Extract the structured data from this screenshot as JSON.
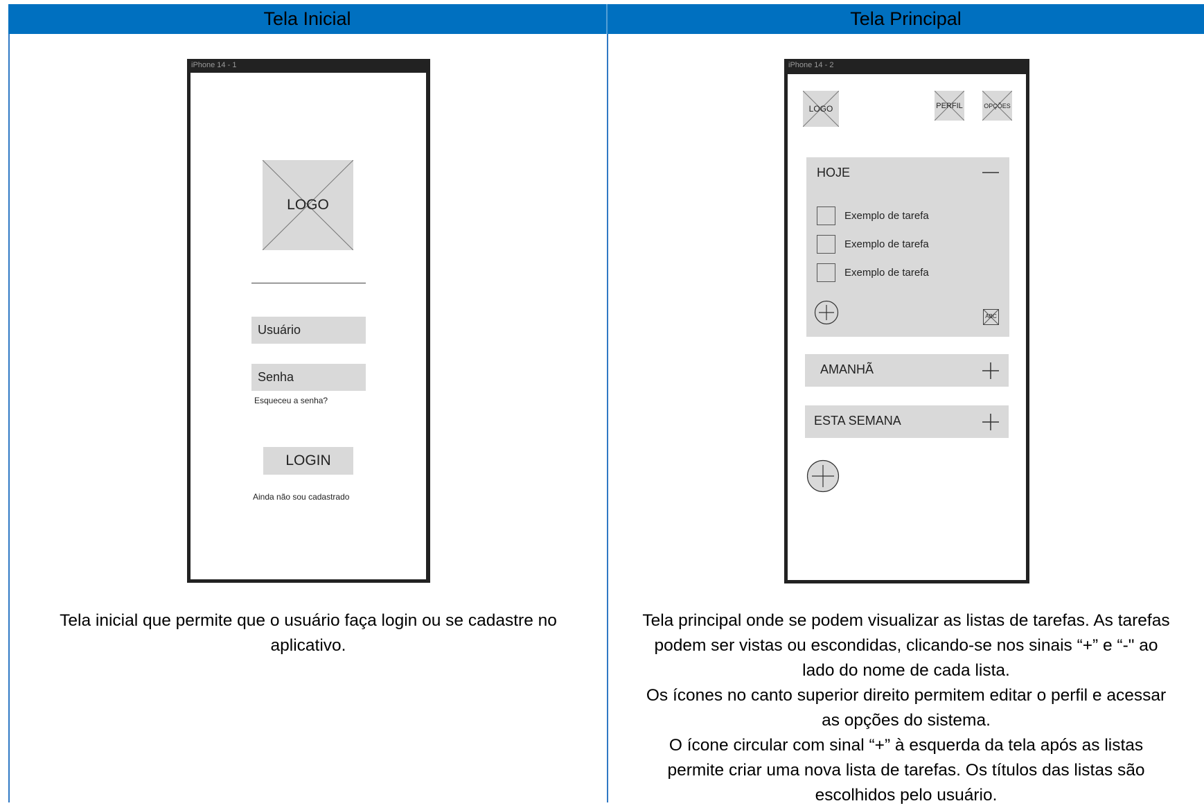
{
  "table": {
    "col1_header": "Tela Inicial",
    "col2_header": "Tela Principal"
  },
  "colors": {
    "header_bg": "#0070c0",
    "border": "#2f78c4",
    "wireframe_gray": "#d9d9d9",
    "phone_frame": "#222222"
  },
  "login_screen": {
    "frame_label": "iPhone 14 - 1",
    "logo": "LOGO",
    "username_placeholder": "Usuário",
    "password_placeholder": "Senha",
    "forgot_password": "Esqueceu a senha?",
    "login_button": "LOGIN",
    "signup_link": "Ainda não sou cadastrado"
  },
  "main_screen": {
    "frame_label": "iPhone 14 - 2",
    "logo": "LOGO",
    "profile_button": "PERFIL",
    "options_button": "OPÇÕES",
    "lists": [
      {
        "title": "HOJE",
        "toggle_icon": "minus-icon",
        "tasks": [
          "Exemplo de tarefa",
          "Exemplo de tarefa",
          "Exemplo de tarefa"
        ],
        "edit_label": "ABC"
      },
      {
        "title": "AMANHÃ",
        "toggle_icon": "plus-icon"
      },
      {
        "title": "ESTA SEMANA",
        "toggle_icon": "plus-icon"
      }
    ],
    "add_list_icon": "circle-plus-icon"
  },
  "descriptions": {
    "col1": [
      "Tela inicial que permite que o usuário faça login ou se cadastre no",
      "aplicativo."
    ],
    "col2": [
      "Tela principal onde se podem visualizar as listas de tarefas. As tarefas",
      "podem ser vistas ou escondidas, clicando-se nos sinais “+” e “-\" ao",
      "lado do nome de cada lista.",
      "Os ícones no canto superior direito permitem editar o perfil e acessar",
      "as opções do sistema.",
      "O ícone circular com sinal “+” à esquerda da tela após as listas",
      "permite criar uma nova lista de tarefas. Os títulos das listas são",
      "escolhidos pelo usuário."
    ]
  }
}
